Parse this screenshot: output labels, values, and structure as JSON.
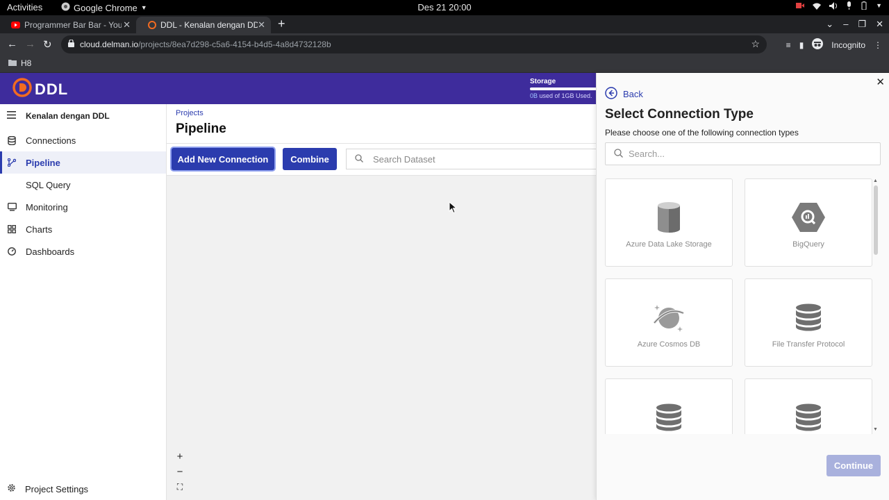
{
  "system_bar": {
    "activities": "Activities",
    "app_name": "Google Chrome",
    "clock": "Des 21  20:00"
  },
  "browser": {
    "tabs": [
      {
        "title": "Programmer Bar Bar - You",
        "favicon": "youtube-icon"
      },
      {
        "title": "DDL - Kenalan dengan DD",
        "favicon": "ddl-icon"
      }
    ],
    "url_host": "cloud.delman.io",
    "url_path": "/projects/8ea7d298-c5a6-4154-b4d5-4a8d4732128b",
    "profile": "Incognito",
    "bookmark_folder": "H8"
  },
  "header": {
    "logo_text": "DDL",
    "storage_title": "Storage",
    "storage_used_amount": "0B",
    "storage_used_rest": " used of 1GB Used."
  },
  "sidebar": {
    "project_name": "Kenalan dengan DDL",
    "items": [
      {
        "label": "Connections",
        "icon": "database-icon"
      },
      {
        "label": "Pipeline",
        "icon": "pipeline-icon"
      },
      {
        "label": "SQL Query",
        "icon": ""
      },
      {
        "label": "Monitoring",
        "icon": "monitor-icon"
      },
      {
        "label": "Charts",
        "icon": "grid-icon"
      },
      {
        "label": "Dashboards",
        "icon": "gauge-icon"
      }
    ],
    "settings_label": "Project Settings"
  },
  "main": {
    "breadcrumb": "Projects",
    "title": "Pipeline",
    "add_connection_label": "Add New Connection",
    "combine_label": "Combine",
    "search_placeholder": "Search Dataset",
    "zoom_in": "+",
    "zoom_out": "−",
    "fit_view": "⛶"
  },
  "panel": {
    "back_label": "Back",
    "title": "Select Connection Type",
    "subtitle": "Please choose one of the following connection types",
    "search_placeholder": "Search...",
    "cards": [
      {
        "label": "Azure Data Lake Storage",
        "icon": "azure-datalake-icon"
      },
      {
        "label": "BigQuery",
        "icon": "bigquery-icon"
      },
      {
        "label": "Azure Cosmos DB",
        "icon": "cosmos-db-icon"
      },
      {
        "label": "File Transfer Protocol",
        "icon": "database-icon"
      },
      {
        "label": "",
        "icon": "database-icon"
      },
      {
        "label": "",
        "icon": "database-icon"
      }
    ],
    "continue_label": "Continue"
  },
  "colors": {
    "brand_header": "#3e2c9c",
    "primary": "#2b3cae",
    "continue_disabled": "#a9b1dd"
  }
}
